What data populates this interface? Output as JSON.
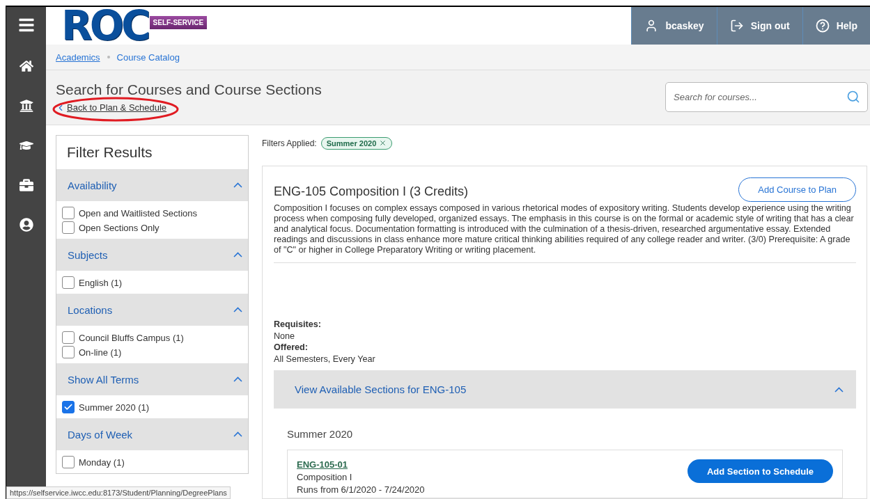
{
  "header": {
    "logo": {
      "text": "ROC",
      "badge": "SELF-SERVICE"
    },
    "user": "bcaskey",
    "actions": [
      "Sign out",
      "Help"
    ]
  },
  "breadcrumbs": [
    {
      "label": "Academics",
      "underlined": true
    },
    {
      "label": "Course Catalog",
      "underlined": false
    }
  ],
  "page_title": "Search for Courses and Course Sections",
  "back_link": {
    "label": "Back to Plan & Schedule",
    "circled": true
  },
  "search": {
    "placeholder": "Search for courses..."
  },
  "filters": {
    "title": "Filter Results",
    "groups": [
      {
        "title": "Availability",
        "expanded": true,
        "options": [
          {
            "label": "Open and Waitlisted Sections",
            "checked": false
          },
          {
            "label": "Open Sections Only",
            "checked": false
          }
        ]
      },
      {
        "title": "Subjects",
        "expanded": true,
        "options": [
          {
            "label": "English (1)",
            "checked": false
          }
        ]
      },
      {
        "title": "Locations",
        "expanded": true,
        "options": [
          {
            "label": "Council Bluffs Campus (1)",
            "checked": false
          },
          {
            "label": "On-line (1)",
            "checked": false
          }
        ]
      },
      {
        "title": "Show All Terms",
        "expanded": true,
        "options": [
          {
            "label": "Summer 2020 (1)",
            "checked": true
          }
        ]
      },
      {
        "title": "Days of Week",
        "expanded": true,
        "options": [
          {
            "label": "Monday (1)",
            "checked": false
          }
        ]
      }
    ]
  },
  "filters_applied": {
    "label": "Filters Applied:",
    "chips": [
      "Summer 2020"
    ]
  },
  "course": {
    "title": "ENG-105 Composition I (3 Credits)",
    "button": "Add Course to Plan",
    "description": "Composition I focuses on complex essays composed in various rhetorical modes of expository writing. Students develop experience using the writing process when composing fully developed, organized essays. The emphasis in this course is on the formal or academic style of writing that has a clear and analytical focus. Documentation formatting is introduced with the culmination of a thesis-driven, researched argumentative essay. Extended readings and discussions in class enhance more mature critical thinking abilities required of any college reader and writer. (3/0) Prerequisite: A grade of \"C\" or higher in College Preparatory Writing or writing placement.",
    "requisites_label": "Requisites:",
    "requisites": "None",
    "offered_label": "Offered:",
    "offered": "All Semesters, Every Year",
    "sections": {
      "title": "View Available Sections for ENG-105",
      "expanded": true,
      "term": "Summer 2020",
      "items": [
        {
          "code": "ENG-105-01",
          "title": "Composition I",
          "dates": "Runs from 6/1/2020 - 7/24/2020",
          "button": "Add Section to Schedule"
        }
      ]
    }
  },
  "status_url": "https://selfservice.iwcc.edu:8173/Student/Planning/DegreePlans"
}
